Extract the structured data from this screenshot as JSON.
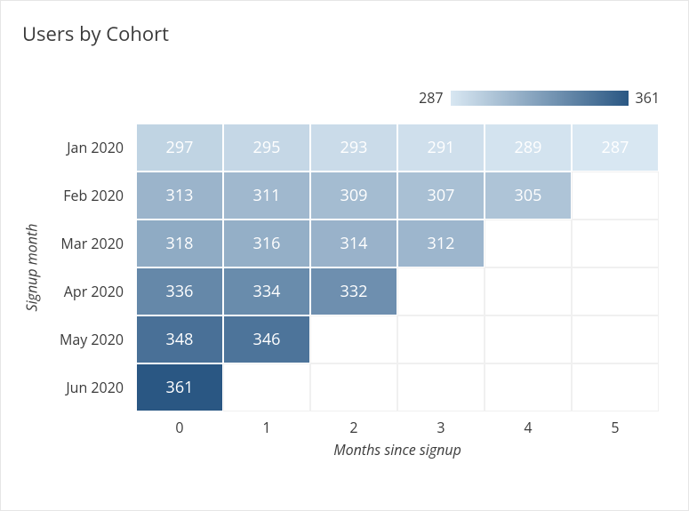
{
  "chart_data": {
    "type": "heatmap",
    "title": "Users by Cohort",
    "xlabel": "Months since signup",
    "ylabel": "Signup month",
    "x_categories": [
      "0",
      "1",
      "2",
      "3",
      "4",
      "5"
    ],
    "y_categories": [
      "Jan 2020",
      "Feb 2020",
      "Mar 2020",
      "Apr 2020",
      "May 2020",
      "Jun 2020"
    ],
    "values": [
      [
        297,
        295,
        293,
        291,
        289,
        287
      ],
      [
        313,
        311,
        309,
        307,
        305,
        null
      ],
      [
        318,
        316,
        314,
        312,
        null,
        null
      ],
      [
        336,
        334,
        332,
        null,
        null,
        null
      ],
      [
        348,
        346,
        null,
        null,
        null,
        null
      ],
      [
        361,
        null,
        null,
        null,
        null,
        null
      ]
    ],
    "color_scale": {
      "min": 287,
      "max": 361,
      "min_color": "#d8e7f2",
      "max_color": "#2a5783"
    }
  }
}
